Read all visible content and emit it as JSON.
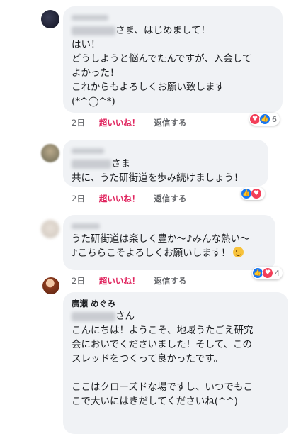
{
  "comments": [
    {
      "name": "",
      "lines": [
        "さま、はじめまして！",
        "はい！",
        "どうしようと悩んでたんですが、入会して",
        "よかった！",
        "これからもよろしくお願い致します",
        "(*^◯^*)"
      ],
      "time": "2日",
      "like_label": "超いいね！",
      "reply_label": "返信する",
      "reaction_count": "6",
      "reactions": [
        "heart",
        "like"
      ]
    },
    {
      "name": "",
      "lines": [
        "さま",
        "共に、うた研街道を歩み続けましょう！"
      ],
      "time": "2日",
      "like_label": "超いいね！",
      "reply_label": "返信する",
      "reaction_count": "",
      "reactions": [
        "like",
        "heart"
      ]
    },
    {
      "name": "",
      "lines": [
        "うた研街道は楽しく豊か〜♪みんな熱い〜",
        "♪こちらこそよろしくお願いします！"
      ],
      "time": "2日",
      "like_label": "超いいね！",
      "reply_label": "返信する",
      "reaction_count": "4",
      "reactions": [
        "like",
        "heart"
      ]
    },
    {
      "name": "廣瀬 めぐみ",
      "lines": [
        "さん",
        "こんにちは！ようこそ、地域うたごえ研究",
        "会においでくださいました！そして、この",
        "スレッドをつくって良かったです。",
        "",
        "ここはクローズドな場ですし、いつでもこ",
        "こで大いにはきだしてくださいね(^^)"
      ]
    }
  ],
  "colors": {
    "bubble": "#f0f2f5",
    "like": "#e0245e",
    "meta": "#65676b",
    "heart": "#f33e58",
    "thumb": "#1877f2"
  },
  "icons": [
    "heart-reaction-icon",
    "like-reaction-icon",
    "wink-emoji-icon"
  ]
}
